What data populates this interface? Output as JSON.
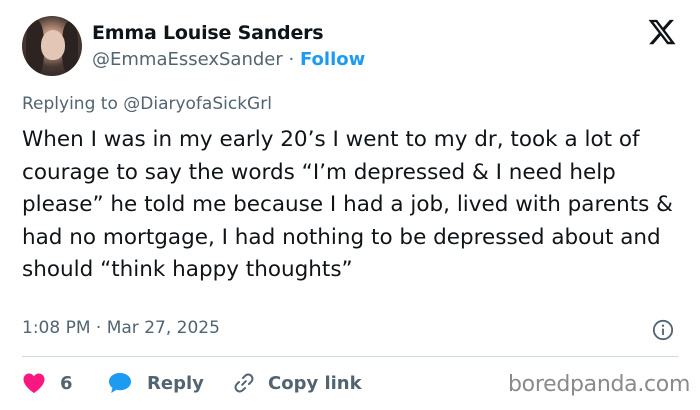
{
  "author": {
    "name": "Emma Louise Sanders",
    "handle": "@EmmaEssexSander",
    "separator": "·",
    "follow_label": "Follow"
  },
  "reply_context": {
    "prefix": "Replying to",
    "mention": "@DiaryofaSickGrl"
  },
  "tweet": {
    "text": "When I was in my early 20’s I went to my dr, took a lot of courage to say the words “I’m depressed & I need help please” he told me because I had a job, lived with parents & had no mortgage, I had nothing to be depressed about and should “think happy thoughts”",
    "timestamp": "1:08 PM · Mar 27, 2025"
  },
  "actions": {
    "like_count": "6",
    "reply_label": "Reply",
    "copy_label": "Copy link"
  },
  "icons": {
    "logo": "x-logo-icon",
    "info": "info-icon",
    "like": "heart-icon",
    "reply": "speech-bubble-icon",
    "copy": "link-icon"
  },
  "colors": {
    "follow": "#1d9bf0",
    "heart": "#f91880",
    "reply_bubble": "#1d9bf0",
    "secondary_text": "#536471"
  },
  "watermark": "boredpanda.com"
}
